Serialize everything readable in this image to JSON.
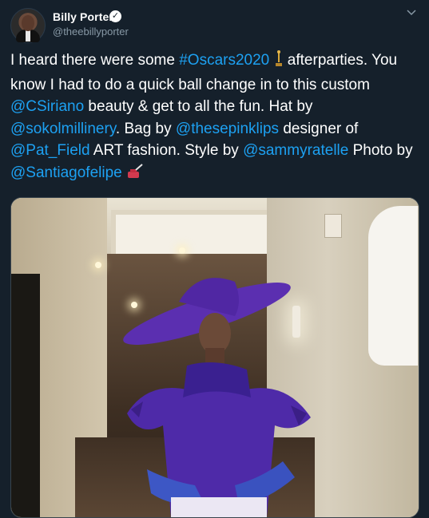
{
  "tweet": {
    "author_name": "Billy Porter",
    "author_handle": "@theebillyporter",
    "verified": true,
    "segments": [
      {
        "text": "I heard there were some ",
        "link": false
      },
      {
        "text": "#Oscars2020",
        "link": true
      },
      {
        "text": " ",
        "link": false
      },
      {
        "text": " afterparties. You know I had to do a quick ball change in to this custom ",
        "link": false
      },
      {
        "text": "@CSiriano",
        "link": true
      },
      {
        "text": " beauty & get to all the fun. Hat by ",
        "link": false
      },
      {
        "text": "@sokolmillinery",
        "link": true
      },
      {
        "text": ". Bag by ",
        "link": false
      },
      {
        "text": "@thesepinklips",
        "link": true
      },
      {
        "text": " designer of ",
        "link": false
      },
      {
        "text": "@Pat_Field",
        "link": true
      },
      {
        "text": " ART fashion. Style by ",
        "link": false
      },
      {
        "text": "@sammyratelle",
        "link": true
      },
      {
        "text": " Photo by ",
        "link": false
      },
      {
        "text": "@Santiagofelipe",
        "link": true
      },
      {
        "text": " ",
        "link": false
      }
    ],
    "emojis": [
      "oscar-statue-icon",
      "nail-polish-icon"
    ]
  },
  "colors": {
    "background": "#15202b",
    "text": "#ffffff",
    "link": "#1da1f2",
    "secondary": "#8899a6"
  },
  "icons": [
    "verified-badge-icon",
    "chevron-down-icon"
  ]
}
